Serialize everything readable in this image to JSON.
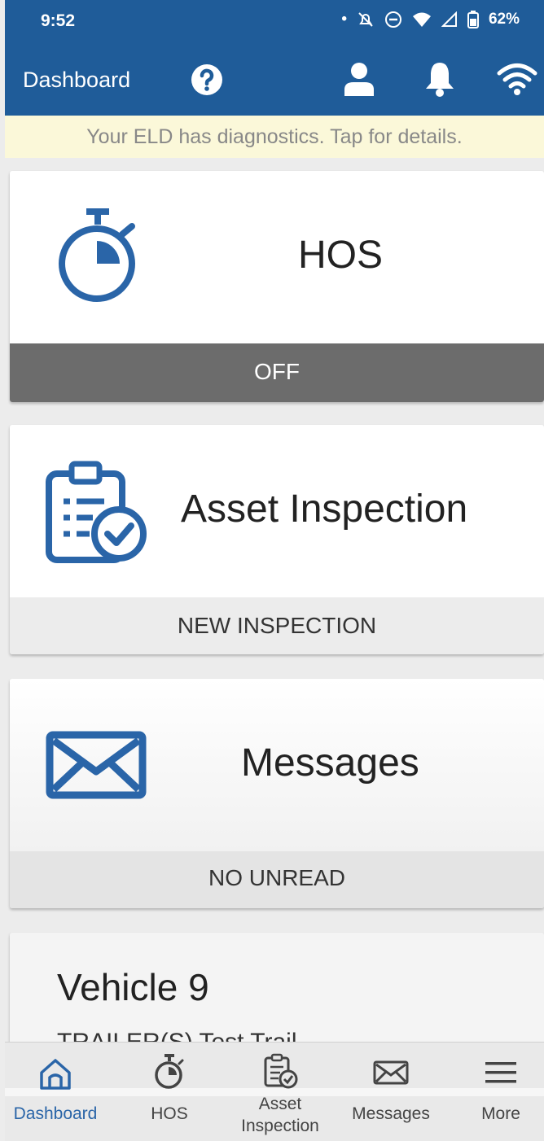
{
  "status_bar": {
    "time": "9:52",
    "battery": "62%"
  },
  "app_bar": {
    "title": "Dashboard",
    "icons": [
      "help-icon",
      "user-icon",
      "bell-icon",
      "wifi-icon"
    ]
  },
  "banner": {
    "text": "Your ELD has diagnostics. Tap for details."
  },
  "cards": {
    "hos": {
      "title": "HOS",
      "status": "OFF",
      "icon": "stopwatch-icon"
    },
    "inspection": {
      "title": "Asset Inspection",
      "action": "NEW INSPECTION",
      "icon": "clipboard-check-icon"
    },
    "messages": {
      "title": "Messages",
      "status": "NO UNREAD",
      "icon": "envelope-icon"
    },
    "vehicle": {
      "title": "Vehicle 9",
      "subtitle": "TRAILER(S)     Test Trail"
    }
  },
  "bottom_nav": {
    "items": [
      {
        "label": "Dashboard",
        "icon": "home-icon",
        "active": true
      },
      {
        "label": "HOS",
        "icon": "stopwatch-icon"
      },
      {
        "label": "Asset\nInspection",
        "icon": "clipboard-check-icon"
      },
      {
        "label": "Messages",
        "icon": "envelope-icon"
      },
      {
        "label": "More",
        "icon": "menu-icon"
      }
    ]
  },
  "colors": {
    "primary": "#1f5c99",
    "banner_bg": "#fbf8d9",
    "hos_status_bg": "#6c6c6c",
    "icon_blue": "#2a65a8"
  }
}
